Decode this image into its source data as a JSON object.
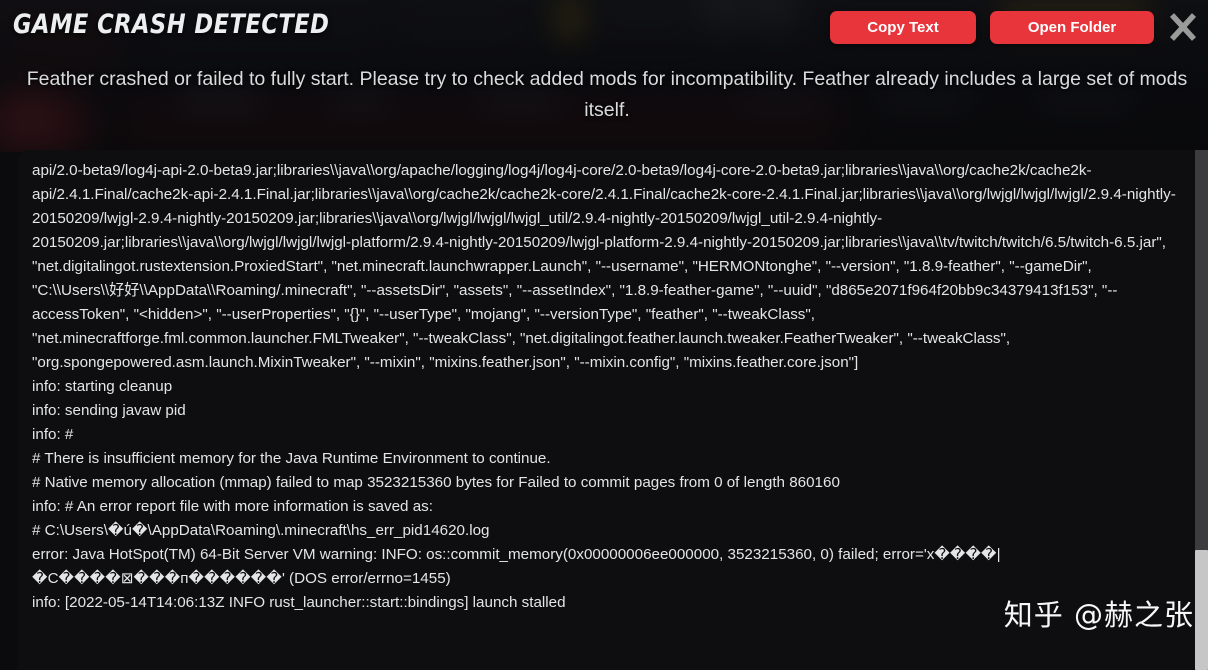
{
  "header": {
    "title": "GAME CRASH DETECTED",
    "subtitle": "Feather crashed or failed to fully start. Please try to check added mods for incompatibility. Feather already includes a large set of mods itself.",
    "copy_label": "Copy Text",
    "folder_label": "Open Folder",
    "close_icon": "close-icon",
    "accent_color": "#e8353c",
    "close_icon_color": "#9a9a9a"
  },
  "log": {
    "lines": [
      "api/2.0-beta9/log4j-api-2.0-beta9.jar;libraries\\\\java\\\\org/apache/logging/log4j/log4j-core/2.0-beta9/log4j-core-2.0-beta9.jar;libraries\\\\java\\\\org/cache2k/cache2k-api/2.4.1.Final/cache2k-api-2.4.1.Final.jar;libraries\\\\java\\\\org/cache2k/cache2k-core/2.4.1.Final/cache2k-core-2.4.1.Final.jar;libraries\\\\java\\\\org/lwjgl/lwjgl/lwjgl/2.9.4-nightly-20150209/lwjgl-2.9.4-nightly-20150209.jar;libraries\\\\java\\\\org/lwjgl/lwjgl/lwjgl_util/2.9.4-nightly-20150209/lwjgl_util-2.9.4-nightly-20150209.jar;libraries\\\\java\\\\org/lwjgl/lwjgl/lwjgl-platform/2.9.4-nightly-20150209/lwjgl-platform-2.9.4-nightly-20150209.jar;libraries\\\\java\\\\tv/twitch/twitch/6.5/twitch-6.5.jar\", \"net.digitalingot.rustextension.ProxiedStart\", \"net.minecraft.launchwrapper.Launch\", \"--username\", \"HERMONtonghe\", \"--version\", \"1.8.9-feather\", \"--gameDir\", \"C:\\\\Users\\\\好好\\\\AppData\\\\Roaming/.minecraft\", \"--assetsDir\", \"assets\", \"--assetIndex\", \"1.8.9-feather-game\", \"--uuid\", \"d865e2071f964f20bb9c34379413f153\", \"--accessToken\", \"<hidden>\", \"--userProperties\", \"{}\", \"--userType\", \"mojang\", \"--versionType\", \"feather\", \"--tweakClass\", \"net.minecraftforge.fml.common.launcher.FMLTweaker\", \"--tweakClass\", \"net.digitalingot.feather.launch.tweaker.FeatherTweaker\", \"--tweakClass\", \"org.spongepowered.asm.launch.MixinTweaker\", \"--mixin\", \"mixins.feather.json\", \"--mixin.config\", \"mixins.feather.core.json\"]",
      "info: starting cleanup",
      "info: sending javaw pid",
      "info: #",
      "# There is insufficient memory for the Java Runtime Environment to continue.",
      "# Native memory allocation (mmap) failed to map 3523215360 bytes for Failed to commit pages from 0 of length 860160",
      "info: # An error report file with more information is saved as:",
      "# C:\\Users\\�ú�\\AppData\\Roaming\\.minecraft\\hs_err_pid14620.log",
      "error: Java HotSpot(TM) 64-Bit Server VM warning: INFO: os::commit_memory(0x00000006ee000000, 3523215360, 0) failed; error='x����|�C����⊠���п������' (DOS error/errno=1455)",
      "info: [2022-05-14T14:06:13Z INFO rust_launcher::start::bindings] launch stalled"
    ]
  },
  "scrollbar": {
    "thumb_top_pct": 77,
    "thumb_height_pct": 23,
    "track_color": "#3c3c3e",
    "thumb_color": "#c6c6c6"
  },
  "watermark": {
    "text": "知乎 @赫之张"
  }
}
